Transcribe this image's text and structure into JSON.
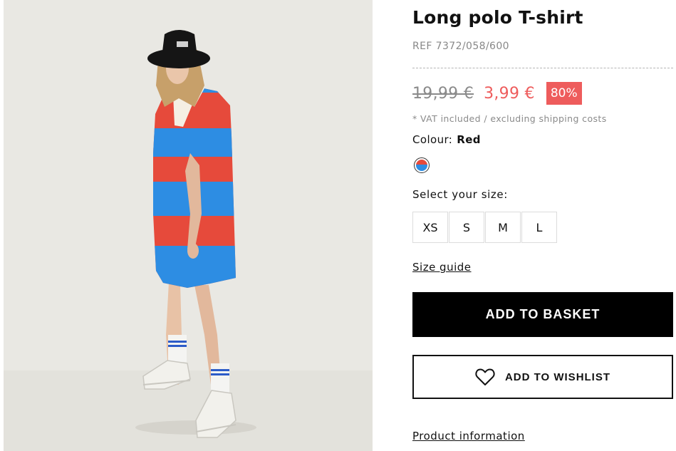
{
  "product": {
    "title": "Long polo T-shirt",
    "ref": "REF 7372/058/600",
    "old_price": "19,99 €",
    "new_price": "3,99 €",
    "discount": "80%",
    "vat_note": "* VAT included / excluding shipping costs",
    "colour_label": "Colour:",
    "colour_value": "Red",
    "select_size_label": "Select your size:",
    "sizes": [
      "XS",
      "S",
      "M",
      "L"
    ],
    "size_guide": "Size guide",
    "add_to_basket": "ADD TO BASKET",
    "add_to_wishlist": "ADD TO WISHLIST",
    "product_information": "Product information"
  },
  "colors": {
    "sale": "#ee5c5c",
    "stripe_red": "#e64a3b",
    "stripe_blue": "#2d8de3",
    "button_dark": "#000000"
  },
  "icons": {
    "wishlist": "heart-icon",
    "swatch": "colour-swatch"
  }
}
